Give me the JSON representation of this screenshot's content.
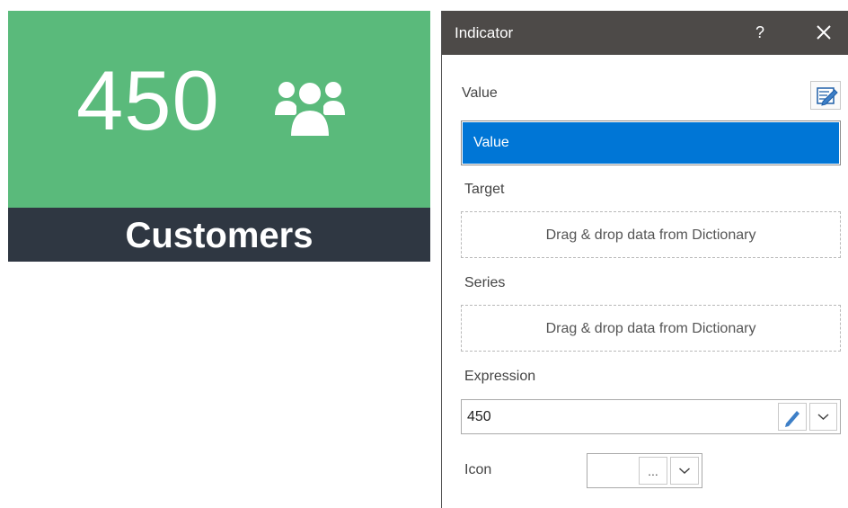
{
  "tile": {
    "value": "450",
    "label": "Customers",
    "icon": "users-group-icon",
    "colors": {
      "top": "#5aba7b",
      "bottom": "#2f3742"
    }
  },
  "panel": {
    "title": "Indicator",
    "help_label": "?",
    "close_icon": "close-icon",
    "fields": {
      "value_label": "Value",
      "value_item": "Value",
      "target_label": "Target",
      "target_placeholder": "Drag & drop data from Dictionary",
      "series_label": "Series",
      "series_placeholder": "Drag & drop data from Dictionary",
      "expression_label": "Expression",
      "expression_value": "450",
      "icon_label": "Icon",
      "icon_browse_label": "..."
    },
    "colors": {
      "header": "#4d4a48",
      "selected": "#0076d6"
    }
  }
}
